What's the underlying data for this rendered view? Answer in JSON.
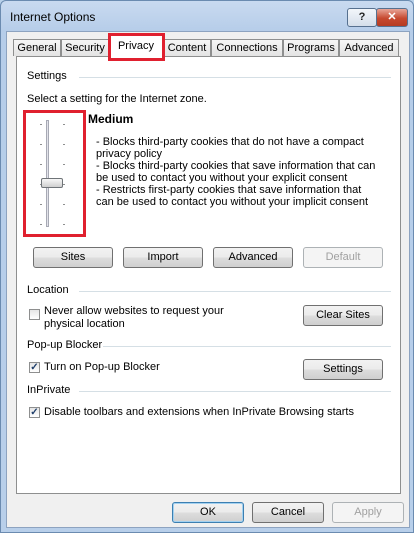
{
  "window": {
    "title": "Internet Options",
    "help_label": "?",
    "close_label": "✕"
  },
  "tabs": [
    {
      "label": "General"
    },
    {
      "label": "Security"
    },
    {
      "label": "Privacy"
    },
    {
      "label": "Content"
    },
    {
      "label": "Connections"
    },
    {
      "label": "Programs"
    },
    {
      "label": "Advanced"
    }
  ],
  "settings": {
    "heading": "Settings",
    "instruction": "Select a setting for the Internet zone.",
    "level": "Medium",
    "slider_position_index": 2,
    "slider_levels": 6,
    "description": [
      "- Blocks third-party cookies that do not have a compact",
      "privacy policy",
      "- Blocks third-party cookies that save information that can",
      "be used to contact you without your explicit consent",
      "- Restricts first-party cookies that save information that",
      "can be used to contact you without your implicit consent"
    ],
    "buttons": {
      "sites": "Sites",
      "import": "Import",
      "advanced": "Advanced",
      "default": "Default"
    }
  },
  "location": {
    "heading": "Location",
    "checkbox_label_1": "Never allow websites to request your",
    "checkbox_label_2": "physical location",
    "checked": false,
    "clear_sites": "Clear Sites"
  },
  "popup": {
    "heading": "Pop-up Blocker",
    "checkbox_label": "Turn on Pop-up Blocker",
    "checked": true,
    "settings_button": "Settings"
  },
  "inprivate": {
    "heading": "InPrivate",
    "checkbox_label": "Disable toolbars and extensions when InPrivate Browsing starts",
    "checked": true
  },
  "footer": {
    "ok": "OK",
    "cancel": "Cancel",
    "apply": "Apply"
  },
  "colors": {
    "highlight": "#e0202f",
    "check": "#1f3f6b"
  }
}
